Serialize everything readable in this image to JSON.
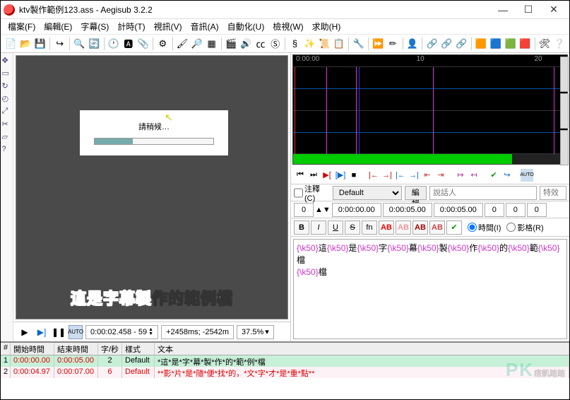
{
  "title": "ktv製作範例123.ass - Aegisub 3.2.2",
  "menus": [
    "檔案(F)",
    "編輯(E)",
    "字幕(S)",
    "計時(T)",
    "視訊(V)",
    "音訊(A)",
    "自動化(U)",
    "檢視(W)",
    "求助(H)"
  ],
  "toolbar_icons": [
    "file-new",
    "file-open",
    "save",
    "sep",
    "redo",
    "sep",
    "find",
    "replace",
    "sep",
    "shift-times",
    "style-mgr",
    "attach",
    "sep",
    "auto",
    "sep",
    "paint",
    "zoom",
    "grid",
    "sep",
    "vid-open",
    "aud-open",
    "cc",
    "sub",
    "sep",
    "snap",
    "effect",
    "script",
    "props",
    "sep",
    "tools",
    "sep",
    "video-jump",
    "ass-draw",
    "sep",
    "avatar",
    "sep",
    "link1",
    "link2",
    "link3",
    "sep",
    "color1",
    "color2",
    "color3",
    "color4",
    "sep",
    "opts",
    "help"
  ],
  "video_dialog_text": "請稍候…",
  "subtitle_past": "這是字幕製",
  "subtitle_future": "作的範例檔",
  "playback": {
    "time": "0:00:02.458 - 59",
    "offset": "+2458ms; -2542m",
    "zoom": "37.5%"
  },
  "audio_ticks": [
    "0:00:00",
    "10",
    "20"
  ],
  "edit": {
    "comment_label": "注釋(C)",
    "style": "Default",
    "edit_btn": "編輯",
    "actor_placeholder": "說話人",
    "effect_placeholder": "特效",
    "layer": "0",
    "start": "0:00:00.00",
    "end": "0:00:05.00",
    "dur": "0:00:05.00",
    "ml": "0",
    "mr": "0",
    "mv": "0",
    "fn_label": "fn",
    "ab_label": "AB",
    "time_radio": "時間(I)",
    "frame_radio": "影格(R)",
    "text_tags": [
      "{\\k50}",
      "這",
      "{\\k50}",
      "是",
      "{\\k50}",
      "字",
      "{\\k50}",
      "幕",
      "{\\k50}",
      "製",
      "{\\k50}",
      "作",
      "{\\k50}",
      "的",
      "{\\k50}",
      "範",
      "{\\k50}",
      "檔"
    ],
    "text_line2_tag": "{\\k50}",
    "text_line2": "檔"
  },
  "grid": {
    "headers": [
      "#",
      "開始時間",
      "結束時間",
      "字/秒",
      "樣式",
      "文本"
    ],
    "rows": [
      {
        "idx": "1",
        "start": "0:00:00.00",
        "end": "0:00:05.00",
        "cps": "2",
        "style": "Default",
        "text": "*這*是*字*幕*製*作*的*範*例*檔"
      },
      {
        "idx": "2",
        "start": "0:00:04.97",
        "end": "0:00:07.00",
        "cps": "6",
        "style": "Default",
        "text": "**影*片*是*隨*便*找*的，*文*字*才*是*重*點**"
      }
    ]
  },
  "watermark": "PK",
  "watermark_sub": "痞凱踏踏"
}
